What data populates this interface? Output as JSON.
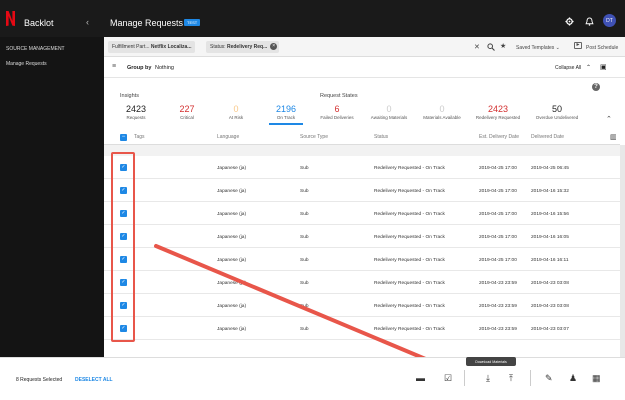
{
  "header": {
    "app_title": "Backlot",
    "page_title": "Manage Requests",
    "env_badge": "TEST",
    "avatar_initials": "DT"
  },
  "sidebar": {
    "items": [
      {
        "label": "SOURCE MANAGEMENT"
      },
      {
        "label": "Manage Requests"
      }
    ]
  },
  "filters": {
    "chips": [
      {
        "prefix": "Fulfillment Part...",
        "value": "Netflix Localiza..."
      },
      {
        "prefix": "Status:",
        "value": "Redelivery Req..."
      }
    ],
    "saved_templates": "Saved Templates",
    "post_schedule": "Post Schedule"
  },
  "group": {
    "label": "Group by",
    "value": "Nothing",
    "collapse_all": "Collapse All"
  },
  "insights": {
    "title": "Insights",
    "stats": [
      {
        "value": "2423",
        "label": "Requests",
        "color": "#222222"
      },
      {
        "value": "227",
        "label": "Critical",
        "color": "#d32f2f"
      },
      {
        "value": "0",
        "label": "At Risk",
        "color": "#f9c98a"
      },
      {
        "value": "2196",
        "label": "On Track",
        "color": "#1e88e5"
      }
    ]
  },
  "request_states": {
    "title": "Request States",
    "stats": [
      {
        "value": "6",
        "label": "Failed Deliveries",
        "color": "#d32f2f"
      },
      {
        "value": "0",
        "label": "Awaiting Materials",
        "color": "#cccccc"
      },
      {
        "value": "0",
        "label": "Materials Available",
        "color": "#cccccc"
      },
      {
        "value": "2423",
        "label": "Redelivery Requested",
        "color": "#d32f2f"
      },
      {
        "value": "50",
        "label": "Overdue Undelivered",
        "color": "#222222"
      }
    ]
  },
  "table": {
    "columns": [
      "Tags",
      "Language",
      "Source Type",
      "Status",
      "Est. Delivery Date",
      "Delivered Date"
    ],
    "rows": [
      {
        "language": "Japanese (ja)",
        "source": "Sub",
        "status": "Redelivery Requested - On Track",
        "est": "2019-04-25 17:00",
        "delivered": "2019-04-25 06:45"
      },
      {
        "language": "Japanese (ja)",
        "source": "Sub",
        "status": "Redelivery Requested - On Track",
        "est": "2019-04-25 17:00",
        "delivered": "2019-04-16 15:32"
      },
      {
        "language": "Japanese (ja)",
        "source": "Sub",
        "status": "Redelivery Requested - On Track",
        "est": "2019-04-25 17:00",
        "delivered": "2019-04-16 15:56"
      },
      {
        "language": "Japanese (ja)",
        "source": "Sub",
        "status": "Redelivery Requested - On Track",
        "est": "2019-04-25 17:00",
        "delivered": "2019-04-16 16:05"
      },
      {
        "language": "Japanese (ja)",
        "source": "Sub",
        "status": "Redelivery Requested - On Track",
        "est": "2019-04-25 17:00",
        "delivered": "2019-04-16 16:11"
      },
      {
        "language": "Japanese (ja)",
        "source": "Sub",
        "status": "Redelivery Requested - On Track",
        "est": "2019-04-23 23:59",
        "delivered": "2019-04-23 03:08"
      },
      {
        "language": "Japanese (ja)",
        "source": "Sub",
        "status": "Redelivery Requested - On Track",
        "est": "2019-04-23 23:59",
        "delivered": "2019-04-23 03:08"
      },
      {
        "language": "Japanese (ja)",
        "source": "Sub",
        "status": "Redelivery Requested - On Track",
        "est": "2019-04-23 23:59",
        "delivered": "2019-04-23 03:07"
      }
    ]
  },
  "bottom": {
    "selected_text": "8 Requests Selected",
    "deselect_all": "DESELECT ALL",
    "tooltip": "Download Materials"
  },
  "colors": {
    "accent": "#1e88e5",
    "annotation": "#e8564a",
    "brand": "#e50914"
  }
}
